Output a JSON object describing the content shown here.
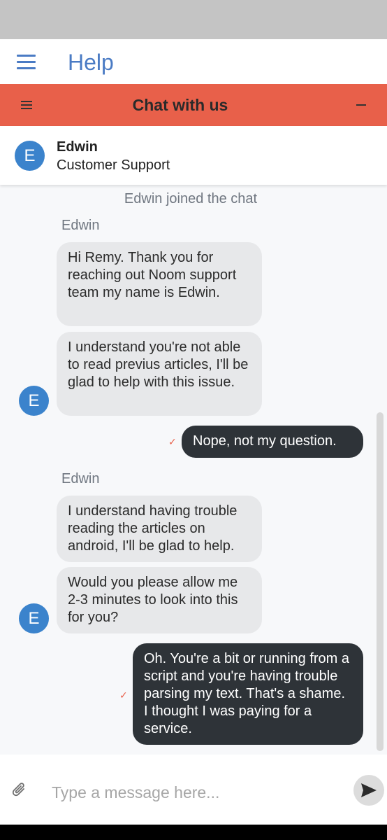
{
  "header": {
    "title": "Help"
  },
  "chat_header": {
    "title": "Chat with us"
  },
  "agent": {
    "initial": "E",
    "name": "Edwin",
    "role": "Customer Support"
  },
  "messages": {
    "system_joined": "Edwin joined the chat",
    "group1": {
      "sender": "Edwin",
      "msg1": "Hi Remy. Thank you for reaching out Noom support team my name is Edwin.",
      "msg2": "I understand you're not able to read previus articles, I'll be glad to help with this issue."
    },
    "user1": "Nope, not my question.",
    "group2": {
      "sender": "Edwin",
      "msg1": "I understand having trouble reading the articles on android, I'll be glad to help.",
      "msg2": "Would you please allow me 2-3 minutes to look into this for you?"
    },
    "user2": "Oh. You're a bit or running from a script and you're having trouble parsing my text. That's a shame. I thought I was paying for a service.",
    "read_check": "✓"
  },
  "input": {
    "placeholder": "Type a message here..."
  },
  "colors": {
    "accent_blue": "#4a7bc4",
    "chat_header": "#e8604a",
    "avatar": "#3b83cc",
    "agent_bubble": "#e7e8ea",
    "user_bubble": "#2e3338"
  },
  "icons": {
    "menu": "menu-icon",
    "chat_menu": "chat-menu-icon",
    "minimize": "minimize-icon",
    "attach": "paperclip-icon",
    "send": "send-icon",
    "read_check": "check-icon"
  }
}
